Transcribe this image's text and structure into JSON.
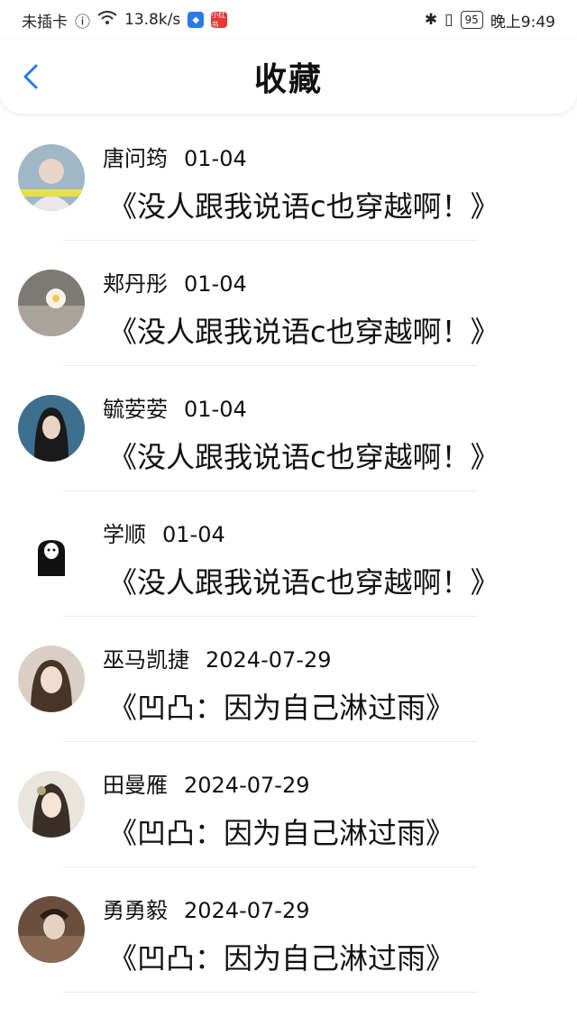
{
  "statusbar": {
    "carrier": "未插卡",
    "net_speed": "13.8k/s",
    "app_badge_2": "小红书",
    "battery": "95",
    "time": "晚上9:49"
  },
  "header": {
    "title": "收藏"
  },
  "items": [
    {
      "name": "唐问筠",
      "date": "01-04",
      "quote": "《没人跟我说语c也穿越啊！》"
    },
    {
      "name": "郏丹彤",
      "date": "01-04",
      "quote": "《没人跟我说语c也穿越啊！》"
    },
    {
      "name": "毓荌荌",
      "date": "01-04",
      "quote": "《没人跟我说语c也穿越啊！》"
    },
    {
      "name": "学顺",
      "date": "01-04",
      "quote": "《没人跟我说语c也穿越啊！》"
    },
    {
      "name": "巫马凯捷",
      "date": "2024-07-29",
      "quote": "《凹凸：因为自己淋过雨》"
    },
    {
      "name": "田曼雁",
      "date": "2024-07-29",
      "quote": "《凹凸：因为自己淋过雨》"
    },
    {
      "name": "勇勇毅",
      "date": "2024-07-29",
      "quote": "《凹凸：因为自己淋过雨》"
    }
  ],
  "colors": {
    "accent": "#2a7be4"
  }
}
